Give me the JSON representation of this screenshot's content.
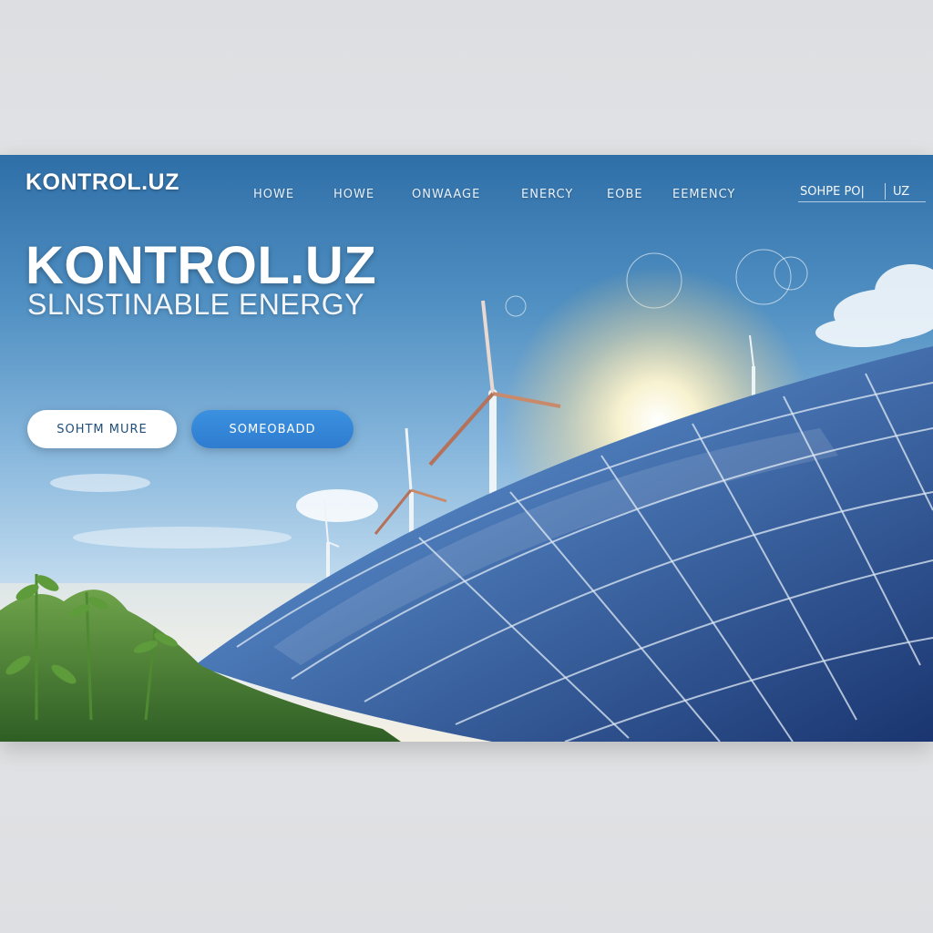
{
  "brand": {
    "logo_text": "KONTROL.UZ"
  },
  "nav": {
    "items": [
      "HOWE",
      "HOWE",
      "ONWAAGE",
      "ENERCY",
      "EOBE",
      "EEMENCY"
    ],
    "search_text": "SOHPE PO|",
    "search_suffix": "UZ"
  },
  "hero": {
    "title": "KONTROL.UZ",
    "subtitle": "SLNSTINABLE ENERGY",
    "body": "",
    "primary_button": "SOHTM MURE",
    "secondary_button": "SOMEOBADD"
  },
  "colors": {
    "sky_top": "#2f6fa8",
    "sky_mid": "#86b6dc",
    "button_primary_bg": "#ffffff",
    "button_secondary_bg": "#2f7cd0",
    "panel_blue": "#1d3f7a"
  },
  "icons": [
    "wind-turbine-icon",
    "solar-panel-icon",
    "sun-icon",
    "leaf-icon"
  ]
}
